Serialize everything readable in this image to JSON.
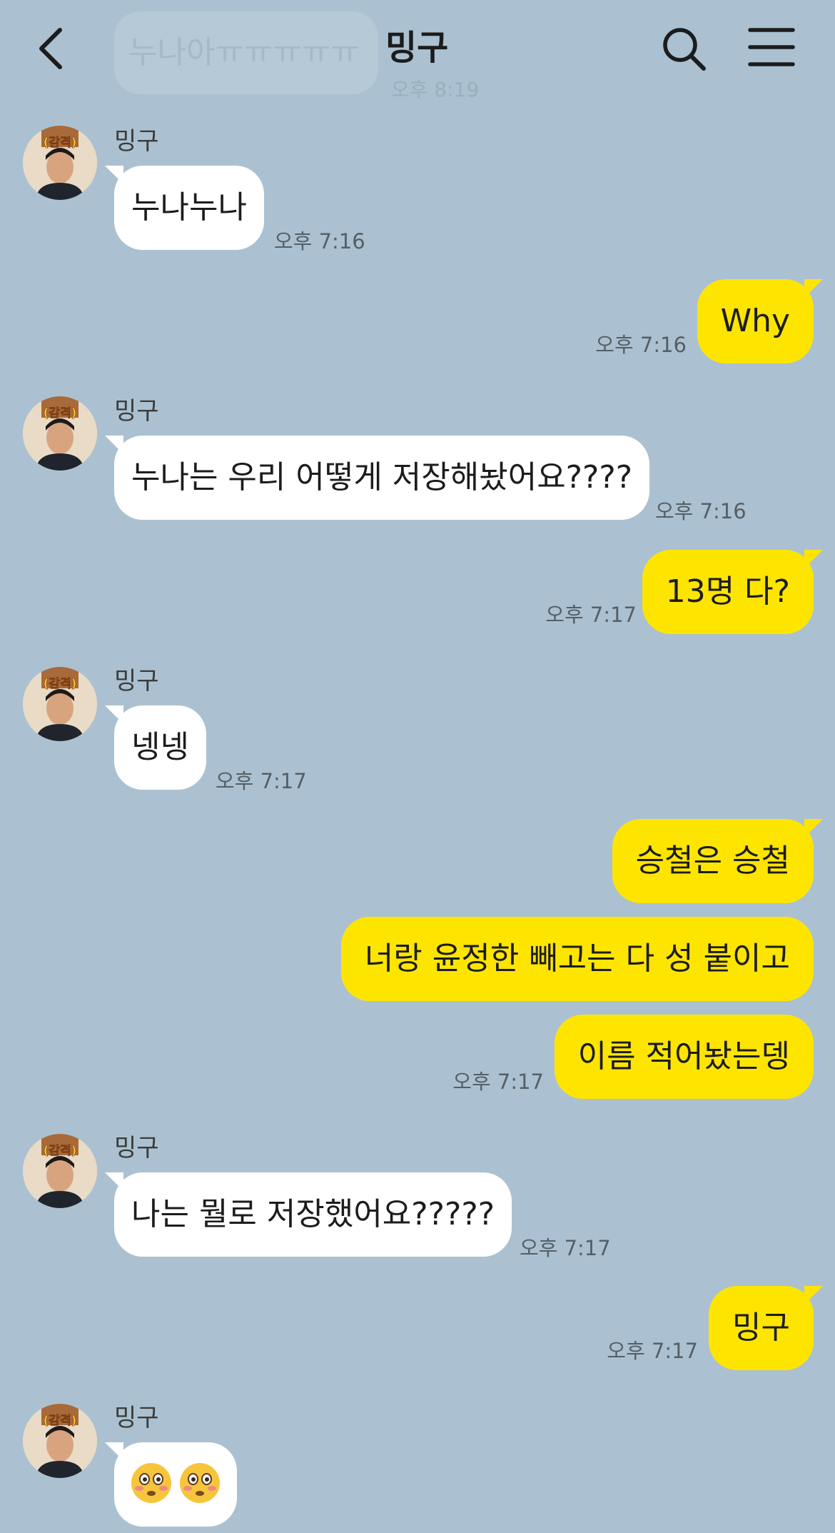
{
  "header": {
    "title": "밍구",
    "back_icon": "chevron-left-icon",
    "search_icon": "search-icon",
    "menu_icon": "hamburger-menu-icon"
  },
  "faded_preview": {
    "text": "누나아ㅠㅠㅠㅠㅠ",
    "time": "오후 8:19"
  },
  "avatar_badge": "(감격)",
  "colors": {
    "background": "#abc1d1",
    "incoming_bubble": "#ffffff",
    "outgoing_bubble": "#fee500"
  },
  "messages": [
    {
      "direction": "in",
      "sender": "밍구",
      "text": "누나누나",
      "time": "오후 7:16"
    },
    {
      "direction": "out",
      "text": "Why",
      "time": "오후 7:16"
    },
    {
      "direction": "in",
      "sender": "밍구",
      "text": "누나는 우리 어떻게 저장해놨어요????",
      "time": "오후 7:16"
    },
    {
      "direction": "out",
      "text": "13명 다?",
      "time": "오후 7:17"
    },
    {
      "direction": "in",
      "sender": "밍구",
      "text": "넹넹",
      "time": "오후 7:17"
    },
    {
      "direction": "out",
      "text": "승철은 승철"
    },
    {
      "direction": "out",
      "text": "너랑 윤정한 빼고는 다 성 붙이고"
    },
    {
      "direction": "out",
      "text": "이름 적어놨는뎅",
      "time": "오후 7:17"
    },
    {
      "direction": "in",
      "sender": "밍구",
      "text": "나는 뭘로 저장했어요?????",
      "time": "오후 7:17"
    },
    {
      "direction": "out",
      "text": "밍구",
      "time": "오후 7:17"
    },
    {
      "direction": "in",
      "sender": "밍구",
      "emoji": [
        "flushed-face-emoji",
        "flushed-face-emoji"
      ]
    }
  ]
}
